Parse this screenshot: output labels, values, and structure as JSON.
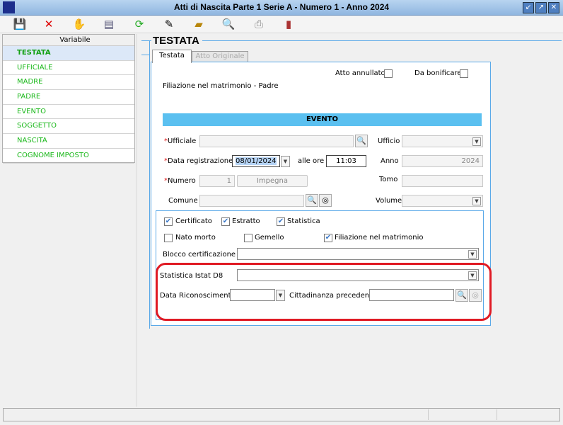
{
  "window": {
    "title": "Atti di Nascita Parte 1 Serie A - Numero 1 - Anno 2024",
    "min": "↙",
    "max": "↗",
    "close": "✕"
  },
  "toolbar": [
    "save-icon",
    "delete-icon",
    "hand-icon",
    "document-icon",
    "refresh-icon",
    "edit-icon",
    "book-icon",
    "search-user-icon",
    "print-icon",
    "archive-icon"
  ],
  "sidebar": {
    "header": "Variabile",
    "items": [
      "TESTATA",
      "UFFICIALE",
      "MADRE",
      "PADRE",
      "EVENTO",
      "SOGGETTO",
      "NASCITA",
      "COGNOME IMPOSTO"
    ]
  },
  "section": "TESTATA",
  "tabs": [
    "Testata",
    "Atto Originale"
  ],
  "form": {
    "atto_annullato": "Atto annullato",
    "da_bonificare": "Da bonificare",
    "filiazione_header": "Filiazione nel matrimonio - Padre",
    "band": "EVENTO",
    "ufficiale": "Ufficiale",
    "ufficio": "Ufficio",
    "data_reg": "Data registrazione",
    "data_reg_value": "08/01/2024",
    "alle_ore": "alle ore",
    "ora_value": "11:03",
    "anno": "Anno",
    "anno_value": "2024",
    "numero": "Numero",
    "numero_value": "1",
    "impegna": "Impegna",
    "tomo": "Tomo",
    "comune": "Comune",
    "volume": "Volume",
    "certificato": "Certificato",
    "estratto": "Estratto",
    "statistica": "Statistica",
    "nato_morto": "Nato morto",
    "gemello": "Gemello",
    "filiazione": "Filiazione nel matrimonio",
    "blocco": "Blocco certificazione",
    "istat": "Statistica Istat D8",
    "data_ric": "Data Riconoscimento",
    "cittadinanza": "Cittadinanza precedente",
    "required_mark": "*"
  },
  "colors": {
    "accent": "#5aa9e8",
    "band": "#5bc0f0",
    "highlight": "#e01a24",
    "sidebar_text": "#1ab81a"
  }
}
